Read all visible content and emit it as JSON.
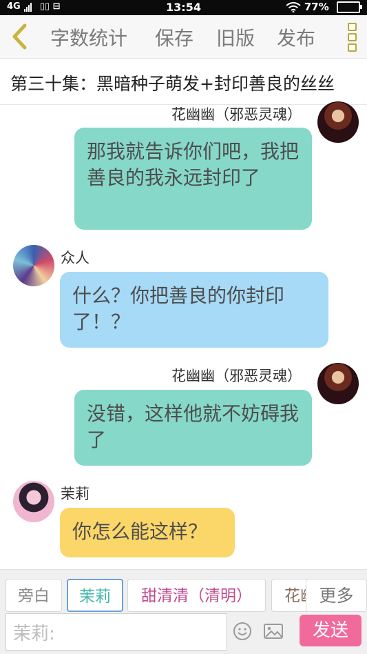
{
  "status": {
    "network": "4G",
    "time": "13:54",
    "battery": "77%"
  },
  "nav": {
    "word_count": "字数统计",
    "save": "保存",
    "old_version": "旧版",
    "publish": "发布"
  },
  "chapter_title": "第三十集：黑暗种子萌发+封印善良的丝丝",
  "messages": [
    {
      "speaker": "花幽幽（邪恶灵魂）",
      "text": "那我就告诉你们吧，我把善良的我永远封印了",
      "color": "#86d8c8"
    },
    {
      "speaker": "众人",
      "text": "什么？你把善良的你封印了！？",
      "color": "#a6daf6"
    },
    {
      "speaker": "花幽幽（邪恶灵魂）",
      "text": "没错，这样他就不妨碍我了",
      "color": "#86d8c8"
    },
    {
      "speaker": "茉莉",
      "text": "你怎么能这样？",
      "color": "#fbd669"
    }
  ],
  "roles": [
    "旁白",
    "茉莉",
    "甜清清（清明）",
    "花幽",
    "更多"
  ],
  "input": {
    "placeholder": "茉莉:",
    "send": "发送"
  }
}
